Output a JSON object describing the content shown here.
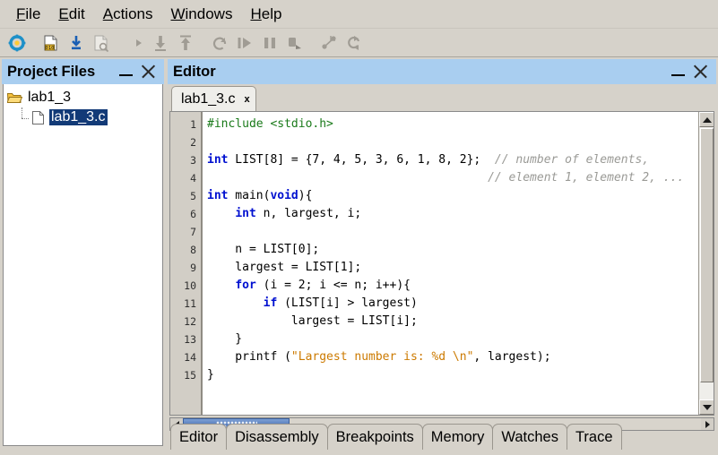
{
  "menu": {
    "items": [
      {
        "label": "File",
        "mnemonic": "F"
      },
      {
        "label": "Edit",
        "mnemonic": "E"
      },
      {
        "label": "Actions",
        "mnemonic": "A"
      },
      {
        "label": "Windows",
        "mnemonic": "W"
      },
      {
        "label": "Help",
        "mnemonic": "H"
      }
    ]
  },
  "toolbar": {
    "buttons": [
      {
        "name": "settings-gear-icon",
        "enabled": true
      },
      {
        "name": "build-binary-icon",
        "enabled": true
      },
      {
        "name": "download-icon",
        "enabled": true
      },
      {
        "name": "debug-document-icon",
        "enabled": false
      },
      {
        "name": "step-into-icon",
        "enabled": false
      },
      {
        "name": "step-over-icon",
        "enabled": false
      },
      {
        "name": "step-out-icon",
        "enabled": false
      },
      {
        "name": "restart-icon",
        "enabled": false
      },
      {
        "name": "run-icon",
        "enabled": false
      },
      {
        "name": "pause-icon",
        "enabled": false
      },
      {
        "name": "stop-icon",
        "enabled": false
      },
      {
        "name": "breakpoint-toggle-icon",
        "enabled": false
      },
      {
        "name": "refresh-icon",
        "enabled": false
      }
    ]
  },
  "project_panel": {
    "title": "Project Files",
    "minimize_label": "minimize",
    "close_label": "close",
    "tree": [
      {
        "label": "lab1_3",
        "icon": "open-folder-icon",
        "level": 0,
        "selected": false
      },
      {
        "label": "lab1_3.c",
        "icon": "file-icon",
        "level": 1,
        "selected": true
      }
    ]
  },
  "editor_panel": {
    "title": "Editor",
    "minimize_label": "minimize",
    "close_label": "close",
    "tabs": [
      {
        "label": "lab1_3.c",
        "close": "x",
        "active": true
      }
    ],
    "line_numbers": [
      "1",
      "2",
      "3",
      "4",
      "5",
      "6",
      "7",
      "8",
      "9",
      "10",
      "11",
      "12",
      "13",
      "14",
      "15"
    ],
    "code_lines": [
      [
        {
          "t": "#include <stdio.h>",
          "c": "pre"
        }
      ],
      [],
      [
        {
          "t": "int",
          "c": "kw"
        },
        {
          "t": " LIST[8] = {7, 4, 5, 3, 6, 1, 8, 2};  ",
          "c": ""
        },
        {
          "t": "// number of elements,",
          "c": "cm"
        }
      ],
      [
        {
          "t": "                                        ",
          "c": ""
        },
        {
          "t": "// element 1, element 2, ...",
          "c": "cm"
        }
      ],
      [
        {
          "t": "int",
          "c": "kw"
        },
        {
          "t": " main(",
          "c": ""
        },
        {
          "t": "void",
          "c": "kw"
        },
        {
          "t": "){",
          "c": ""
        }
      ],
      [
        {
          "t": "    ",
          "c": ""
        },
        {
          "t": "int",
          "c": "kw"
        },
        {
          "t": " n, largest, i;",
          "c": ""
        }
      ],
      [],
      [
        {
          "t": "    n = LIST[0];",
          "c": ""
        }
      ],
      [
        {
          "t": "    largest = LIST[1];",
          "c": ""
        }
      ],
      [
        {
          "t": "    ",
          "c": ""
        },
        {
          "t": "for",
          "c": "kw"
        },
        {
          "t": " (i = 2; i <= n; i++){",
          "c": ""
        }
      ],
      [
        {
          "t": "        ",
          "c": ""
        },
        {
          "t": "if",
          "c": "kw"
        },
        {
          "t": " (LIST[i] > largest)",
          "c": ""
        }
      ],
      [
        {
          "t": "            largest = LIST[i];",
          "c": ""
        }
      ],
      [
        {
          "t": "    }",
          "c": ""
        }
      ],
      [
        {
          "t": "    printf (",
          "c": ""
        },
        {
          "t": "\"Largest number is: %d \\n\"",
          "c": "str"
        },
        {
          "t": ", largest);",
          "c": ""
        }
      ],
      [
        {
          "t": "}",
          "c": ""
        }
      ]
    ],
    "scrollbars": {
      "vertical_up": "scroll-up",
      "vertical_down": "scroll-down",
      "horizontal_left": "scroll-left",
      "horizontal_right": "scroll-right"
    }
  },
  "bottom_tabs": [
    {
      "label": "Editor",
      "active": true
    },
    {
      "label": "Disassembly",
      "active": false
    },
    {
      "label": "Breakpoints",
      "active": false
    },
    {
      "label": "Memory",
      "active": false
    },
    {
      "label": "Watches",
      "active": false
    },
    {
      "label": "Trace",
      "active": false
    }
  ],
  "colors": {
    "titlebar": "#a9cef0",
    "chrome": "#d6d2ca",
    "selection": "#123a77",
    "keyword": "#0010d0",
    "preprocessor": "#1a7a1a",
    "comment": "#9a9a96",
    "string": "#cc7a00",
    "scroll_thumb": "#5b80bf"
  }
}
